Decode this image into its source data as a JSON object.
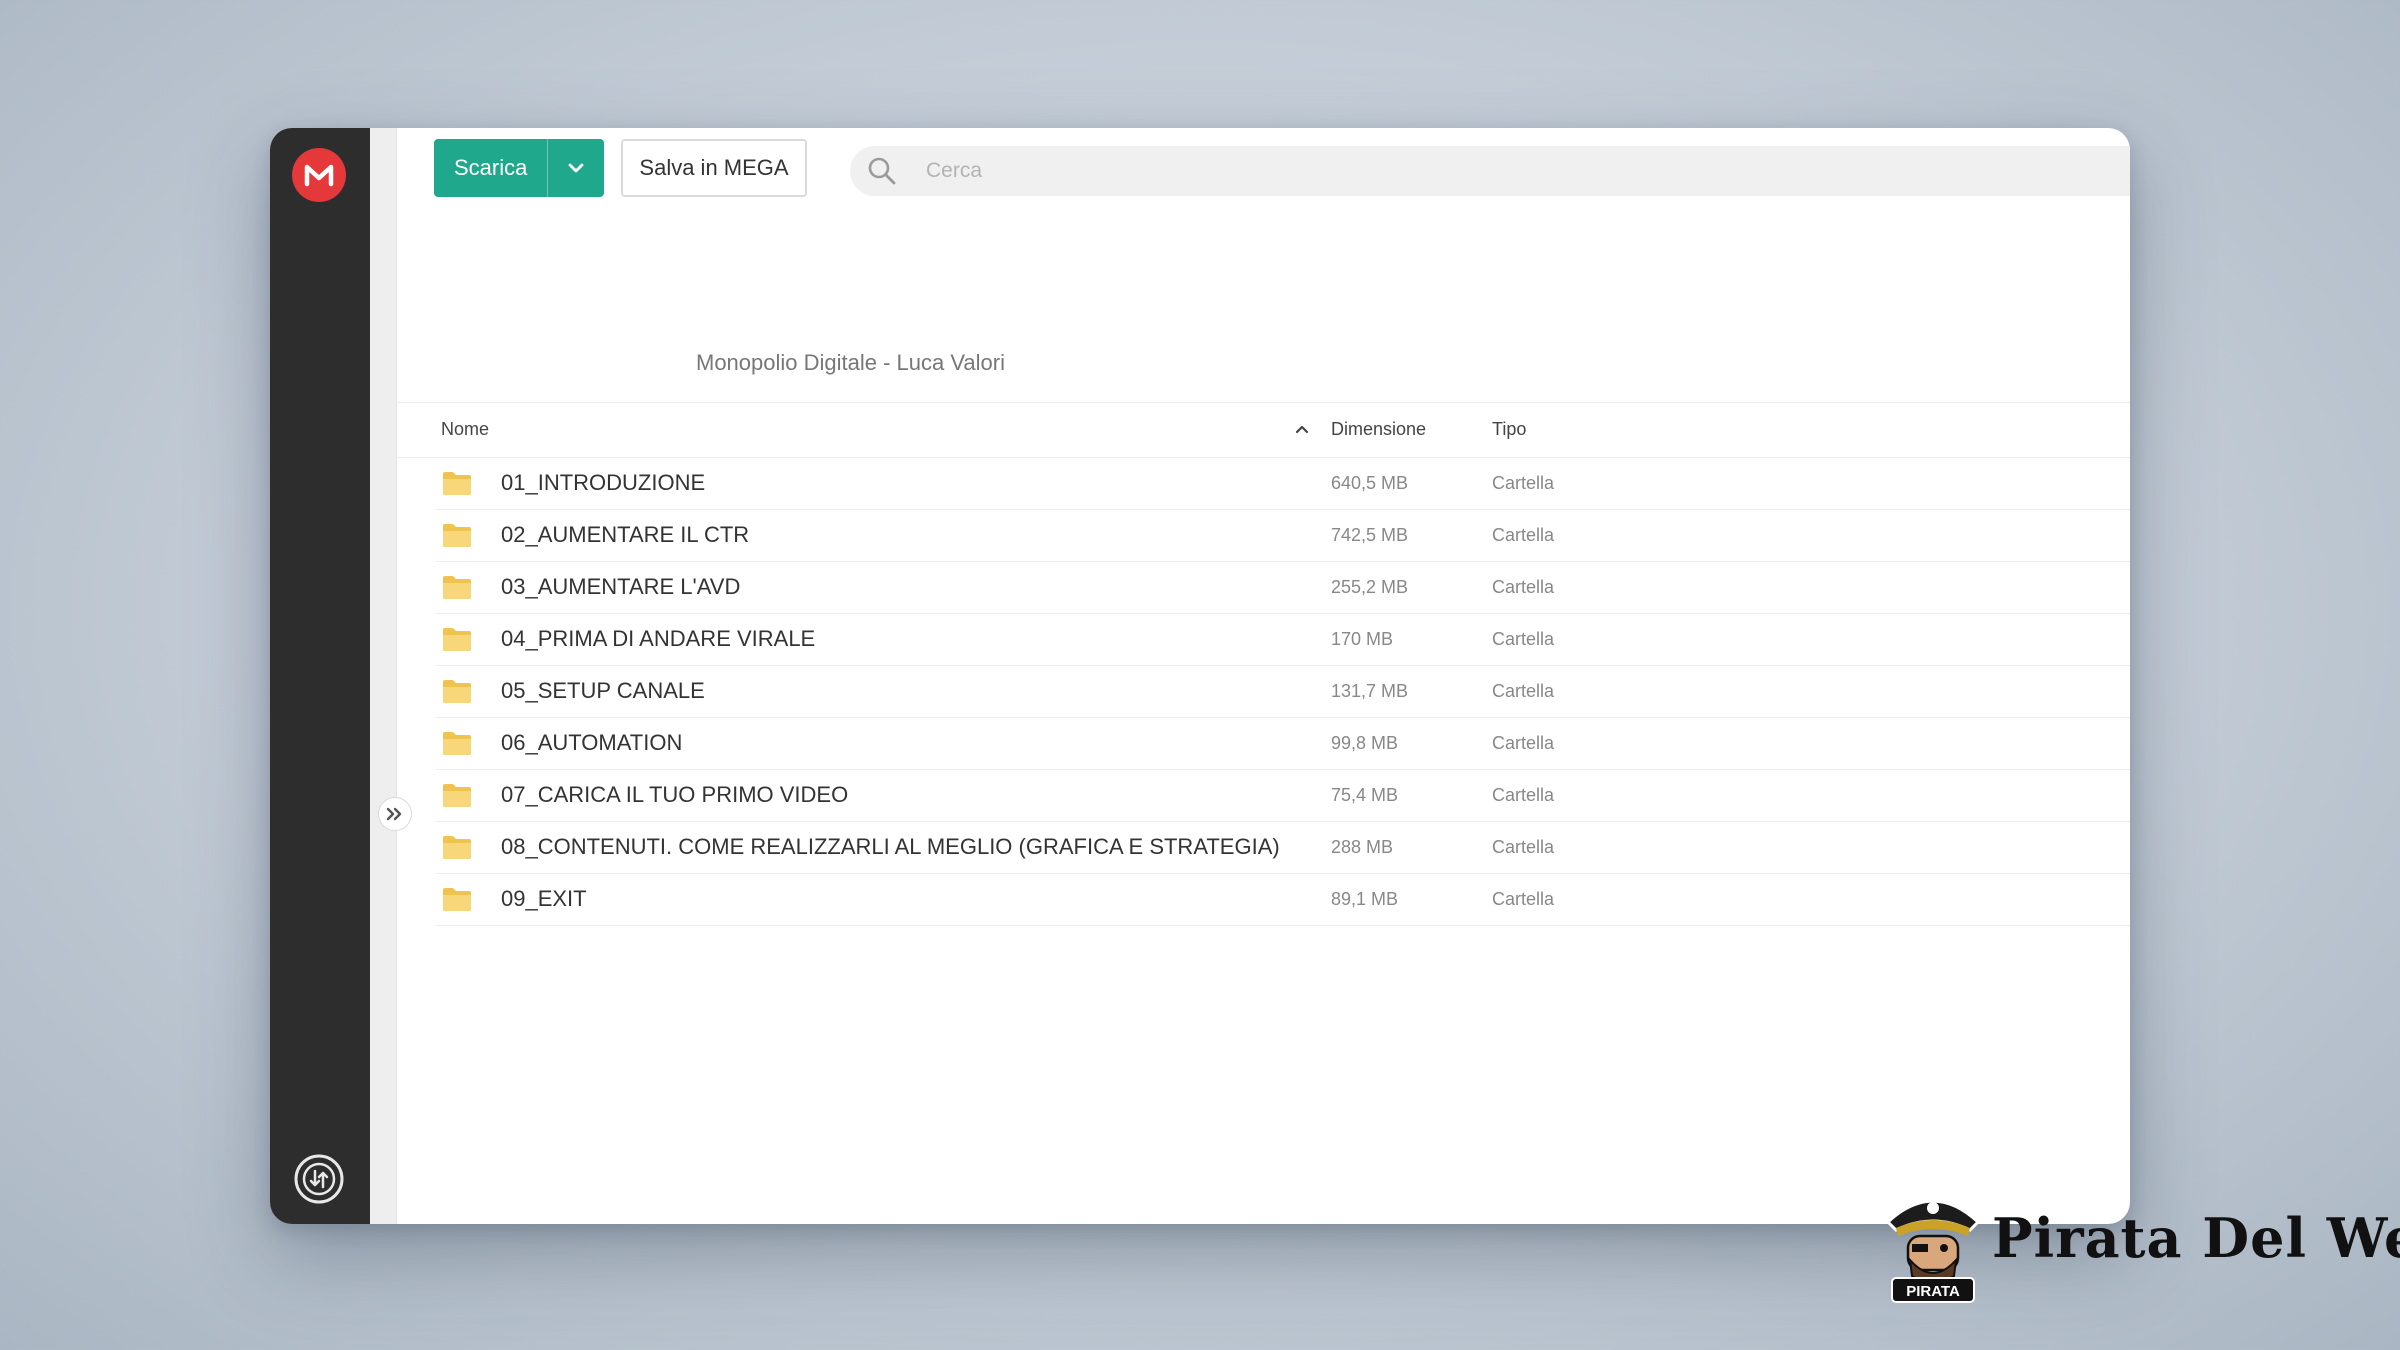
{
  "toolbar": {
    "download_label": "Scarica",
    "save_label": "Salva in MEGA",
    "search_placeholder": "Cerca"
  },
  "breadcrumb": "Monopolio Digitale - Luca Valori",
  "table": {
    "headers": {
      "name": "Nome",
      "size": "Dimensione",
      "type": "Tipo"
    },
    "rows": [
      {
        "name": "01_INTRODUZIONE",
        "size": "640,5 MB",
        "type": "Cartella"
      },
      {
        "name": "02_AUMENTARE IL CTR",
        "size": "742,5 MB",
        "type": "Cartella"
      },
      {
        "name": "03_AUMENTARE L'AVD",
        "size": "255,2 MB",
        "type": "Cartella"
      },
      {
        "name": "04_PRIMA DI ANDARE VIRALE",
        "size": "170 MB",
        "type": "Cartella"
      },
      {
        "name": "05_SETUP CANALE",
        "size": "131,7 MB",
        "type": "Cartella"
      },
      {
        "name": "06_AUTOMATION",
        "size": "99,8 MB",
        "type": "Cartella"
      },
      {
        "name": "07_CARICA IL TUO PRIMO VIDEO",
        "size": "75,4 MB",
        "type": "Cartella"
      },
      {
        "name": "08_CONTENUTI. COME REALIZZARLI AL MEGLIO (GRAFICA E STRATEGIA)",
        "size": "288 MB",
        "type": "Cartella"
      },
      {
        "name": "09_EXIT",
        "size": "89,1 MB",
        "type": "Cartella"
      }
    ]
  },
  "watermark": {
    "brand": "Pirata Del Web",
    "badge": "PIRATA"
  },
  "colors": {
    "accent": "#1fa88b",
    "logo_red": "#e5383b",
    "sidebar": "#2d2d2d",
    "folder": "#f5cf6b"
  },
  "icons": [
    "mega-logo-icon",
    "transfer-manager-icon",
    "expand-icon",
    "chevron-down-icon",
    "search-icon",
    "sort-up-icon",
    "folder-icon"
  ]
}
